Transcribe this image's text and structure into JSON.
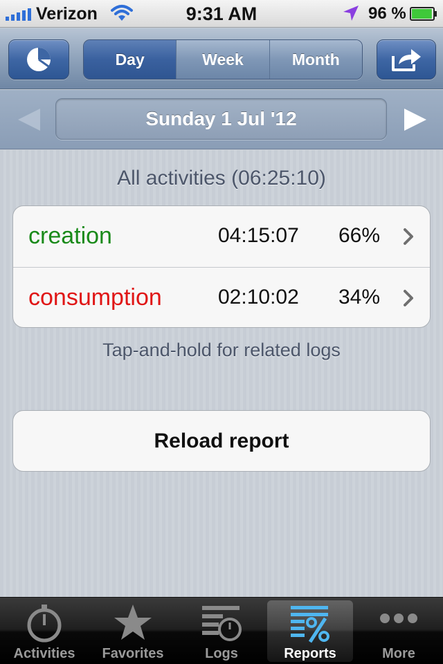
{
  "status": {
    "carrier": "Verizon",
    "time": "9:31 AM",
    "battery_pct": "96 %",
    "battery_level": 0.96
  },
  "nav": {
    "segments": [
      {
        "label": "Day",
        "selected": true
      },
      {
        "label": "Week",
        "selected": false
      },
      {
        "label": "Month",
        "selected": false
      }
    ]
  },
  "date": {
    "label": "Sunday 1 Jul '12"
  },
  "report": {
    "header": "All activities (06:25:10)",
    "rows": [
      {
        "name": "creation",
        "time": "04:15:07",
        "percent": "66%",
        "color": "#1a8a1a"
      },
      {
        "name": "consumption",
        "time": "02:10:02",
        "percent": "34%",
        "color": "#e01616"
      }
    ],
    "footer": "Tap-and-hold for related logs",
    "reload_label": "Reload report"
  },
  "tabs": [
    {
      "label": "Activities",
      "icon": "stopwatch-icon",
      "selected": false
    },
    {
      "label": "Favorites",
      "icon": "star-icon",
      "selected": false
    },
    {
      "label": "Logs",
      "icon": "logs-icon",
      "selected": false
    },
    {
      "label": "Reports",
      "icon": "percent-icon",
      "selected": true
    },
    {
      "label": "More",
      "icon": "more-dots-icon",
      "selected": false
    }
  ],
  "colors": {
    "accent_blue": "#3a619f",
    "tab_selected_blue": "#4fb6f0"
  }
}
